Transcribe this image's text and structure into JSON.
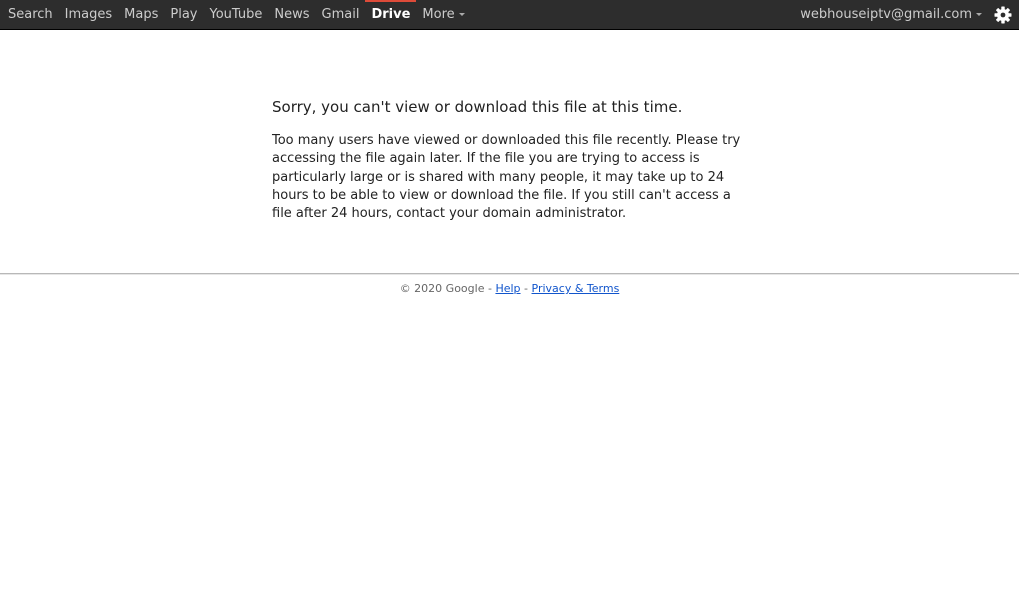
{
  "nav": {
    "items": [
      {
        "label": "Search"
      },
      {
        "label": "Images"
      },
      {
        "label": "Maps"
      },
      {
        "label": "Play"
      },
      {
        "label": "YouTube"
      },
      {
        "label": "News"
      },
      {
        "label": "Gmail"
      },
      {
        "label": "Drive"
      },
      {
        "label": "More"
      }
    ],
    "active": "Drive"
  },
  "account": {
    "email": "webhouseiptv@gmail.com"
  },
  "error": {
    "title": "Sorry, you can't view or download this file at this time.",
    "message": "Too many users have viewed or downloaded this file recently. Please try accessing the file again later. If the file you are trying to access is particularly large or is shared with many people, it may take up to 24 hours to be able to view or download the file. If you still can't access a file after 24 hours, contact your domain administrator."
  },
  "footer": {
    "copyright": "© 2020 Google",
    "separator": "-",
    "help_label": "Help",
    "privacy_label": "Privacy & Terms"
  },
  "colors": {
    "topbar_bg": "#2d2d2d",
    "active_accent": "#dd4b39",
    "link": "#1155cc"
  },
  "icons": {
    "settings": "gear-icon",
    "dropdown": "caret-down-icon"
  }
}
